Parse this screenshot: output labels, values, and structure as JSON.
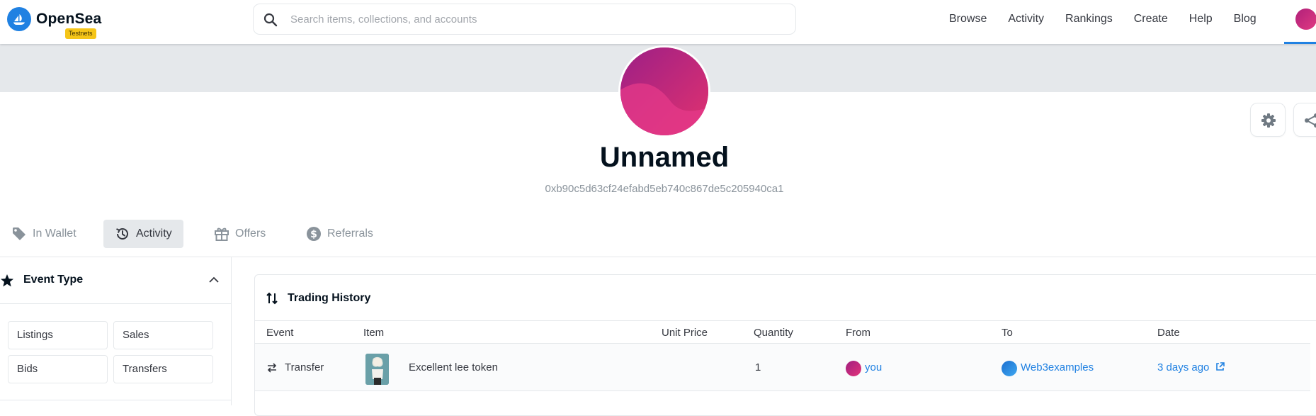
{
  "nav": {
    "brand": "OpenSea",
    "badge": "Testnets",
    "search_placeholder": "Search items, collections, and accounts",
    "links": [
      "Browse",
      "Activity",
      "Rankings",
      "Create",
      "Help",
      "Blog"
    ]
  },
  "profile": {
    "name": "Unnamed",
    "address": "0xb90c5d63cf24efabd5eb740c867de5c205940ca1"
  },
  "tabs": [
    {
      "label": "In Wallet",
      "icon": "tag-icon",
      "active": false
    },
    {
      "label": "Activity",
      "icon": "history-icon",
      "active": true
    },
    {
      "label": "Offers",
      "icon": "gift-icon",
      "active": false
    },
    {
      "label": "Referrals",
      "icon": "dollar-circle-icon",
      "active": false
    }
  ],
  "filters": {
    "title": "Event Type",
    "buttons": [
      "Listings",
      "Sales",
      "Bids",
      "Transfers"
    ]
  },
  "history": {
    "title": "Trading History",
    "columns": [
      "Event",
      "Item",
      "Unit Price",
      "Quantity",
      "From",
      "To",
      "Date"
    ],
    "rows": [
      {
        "event": "Transfer",
        "item": "Excellent lee token",
        "unit_price": "",
        "quantity": "1",
        "from": "you",
        "to": "Web3examples",
        "date": "3 days ago"
      }
    ]
  },
  "colors": {
    "accent": "#2081e2",
    "badge": "#f5c518",
    "avatar": "#c71f7a"
  }
}
